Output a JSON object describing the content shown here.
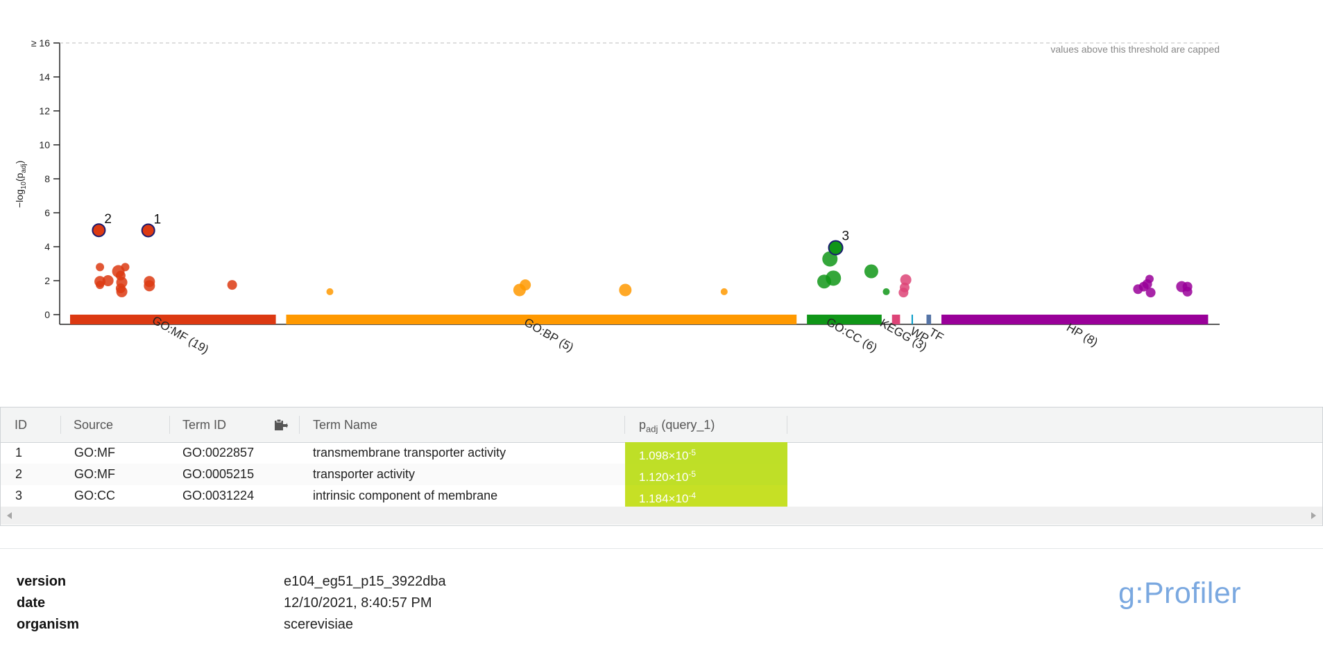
{
  "chart_data": {
    "type": "scatter",
    "ylabel_parts": {
      "prefix": "−log",
      "sub10": "10",
      "mid": "(p",
      "subadj": "adj",
      "suffix": ")"
    },
    "ylim": [
      0,
      16
    ],
    "yticks": [
      "0",
      "2",
      "4",
      "6",
      "8",
      "10",
      "12",
      "14",
      "≥ 16"
    ],
    "cap_note": "values above this threshold are capped",
    "grid": false,
    "sources": [
      {
        "label": "GO:MF (19)",
        "color": "#dc3912",
        "range": [
          0,
          0.179
        ]
      },
      {
        "label": "GO:BP (5)",
        "color": "#ff9900",
        "range": [
          0.188,
          0.632
        ]
      },
      {
        "label": "GO:CC (6)",
        "color": "#109618",
        "range": [
          0.641,
          0.706
        ]
      },
      {
        "label": "KEGG (3)",
        "color": "#dd4477",
        "range": [
          0.715,
          0.722
        ]
      },
      {
        "label": "WP",
        "color": "#0099c6",
        "range": [
          0.732,
          0.733
        ]
      },
      {
        "label": "TF",
        "color": "#5574a6",
        "range": [
          0.745,
          0.749
        ]
      },
      {
        "label": "HP (8)",
        "color": "#990099",
        "range": [
          0.758,
          0.99
        ]
      }
    ],
    "points": [
      {
        "source": "GO:MF",
        "x": 0.025,
        "y": 4.97,
        "size": 9,
        "highlight": true,
        "label": "2"
      },
      {
        "source": "GO:MF",
        "x": 0.068,
        "y": 4.96,
        "size": 9,
        "highlight": true,
        "label": "1"
      },
      {
        "source": "GO:MF",
        "x": 0.026,
        "y": 2.8,
        "size": 6
      },
      {
        "source": "GO:MF",
        "x": 0.026,
        "y": 1.95,
        "size": 8
      },
      {
        "source": "GO:MF",
        "x": 0.026,
        "y": 1.75,
        "size": 6
      },
      {
        "source": "GO:MF",
        "x": 0.033,
        "y": 2.0,
        "size": 8
      },
      {
        "source": "GO:MF",
        "x": 0.042,
        "y": 2.55,
        "size": 9
      },
      {
        "source": "GO:MF",
        "x": 0.048,
        "y": 2.8,
        "size": 6
      },
      {
        "source": "GO:MF",
        "x": 0.044,
        "y": 2.3,
        "size": 7
      },
      {
        "source": "GO:MF",
        "x": 0.045,
        "y": 1.9,
        "size": 8
      },
      {
        "source": "GO:MF",
        "x": 0.045,
        "y": 1.35,
        "size": 8
      },
      {
        "source": "GO:MF",
        "x": 0.044,
        "y": 1.55,
        "size": 7
      },
      {
        "source": "GO:MF",
        "x": 0.069,
        "y": 1.95,
        "size": 8
      },
      {
        "source": "GO:MF",
        "x": 0.069,
        "y": 1.7,
        "size": 8
      },
      {
        "source": "GO:MF",
        "x": 0.141,
        "y": 1.75,
        "size": 7
      },
      {
        "source": "GO:BP",
        "x": 0.226,
        "y": 1.35,
        "size": 5
      },
      {
        "source": "GO:BP",
        "x": 0.391,
        "y": 1.45,
        "size": 9
      },
      {
        "source": "GO:BP",
        "x": 0.396,
        "y": 1.75,
        "size": 8
      },
      {
        "source": "GO:BP",
        "x": 0.483,
        "y": 1.45,
        "size": 9
      },
      {
        "source": "GO:BP",
        "x": 0.569,
        "y": 1.35,
        "size": 5
      },
      {
        "source": "GO:CC",
        "x": 0.661,
        "y": 3.28,
        "size": 11
      },
      {
        "source": "GO:CC",
        "x": 0.656,
        "y": 1.95,
        "size": 10
      },
      {
        "source": "GO:CC",
        "x": 0.664,
        "y": 2.15,
        "size": 11
      },
      {
        "source": "GO:CC",
        "x": 0.666,
        "y": 3.94,
        "size": 10,
        "highlight": true,
        "label": "3"
      },
      {
        "source": "GO:CC",
        "x": 0.697,
        "y": 2.55,
        "size": 10
      },
      {
        "source": "GO:CC",
        "x": 0.71,
        "y": 1.35,
        "size": 5
      },
      {
        "source": "KEGG",
        "x": 0.727,
        "y": 2.05,
        "size": 8
      },
      {
        "source": "KEGG",
        "x": 0.726,
        "y": 1.6,
        "size": 7
      },
      {
        "source": "KEGG",
        "x": 0.725,
        "y": 1.3,
        "size": 7
      },
      {
        "source": "HP",
        "x": 0.929,
        "y": 1.5,
        "size": 7
      },
      {
        "source": "HP",
        "x": 0.934,
        "y": 1.65,
        "size": 7
      },
      {
        "source": "HP",
        "x": 0.937,
        "y": 1.8,
        "size": 7
      },
      {
        "source": "HP",
        "x": 0.939,
        "y": 2.1,
        "size": 6
      },
      {
        "source": "HP",
        "x": 0.94,
        "y": 1.3,
        "size": 7
      },
      {
        "source": "HP",
        "x": 0.967,
        "y": 1.65,
        "size": 8
      },
      {
        "source": "HP",
        "x": 0.972,
        "y": 1.65,
        "size": 7
      },
      {
        "source": "HP",
        "x": 0.972,
        "y": 1.35,
        "size": 7
      }
    ]
  },
  "table": {
    "headers": {
      "id": "ID",
      "source": "Source",
      "term_id": "Term ID",
      "term_name": "Term Name",
      "padj_main": "p",
      "padj_sub": "adj",
      "padj_rest": " (query_1)"
    },
    "rows": [
      {
        "id": "1",
        "source": "GO:MF",
        "term_id": "GO:0022857",
        "term_name": "transmembrane transporter activity",
        "padj_mant": "1.098×10",
        "padj_exp": "-5",
        "color": "#bedf27"
      },
      {
        "id": "2",
        "source": "GO:MF",
        "term_id": "GO:0005215",
        "term_name": "transporter activity",
        "padj_mant": "1.120×10",
        "padj_exp": "-5",
        "color": "#bfdf27"
      },
      {
        "id": "3",
        "source": "GO:CC",
        "term_id": "GO:0031224",
        "term_name": "intrinsic component of membrane",
        "padj_mant": "1.184×10",
        "padj_exp": "-4",
        "color": "#c6e025"
      }
    ]
  },
  "meta": {
    "version_label": "version",
    "version_value": "e104_eg51_p15_3922dba",
    "date_label": "date",
    "date_value": "12/10/2021, 8:40:57 PM",
    "organism_label": "organism",
    "organism_value": "scerevisiae"
  },
  "brand": "g:Profiler"
}
